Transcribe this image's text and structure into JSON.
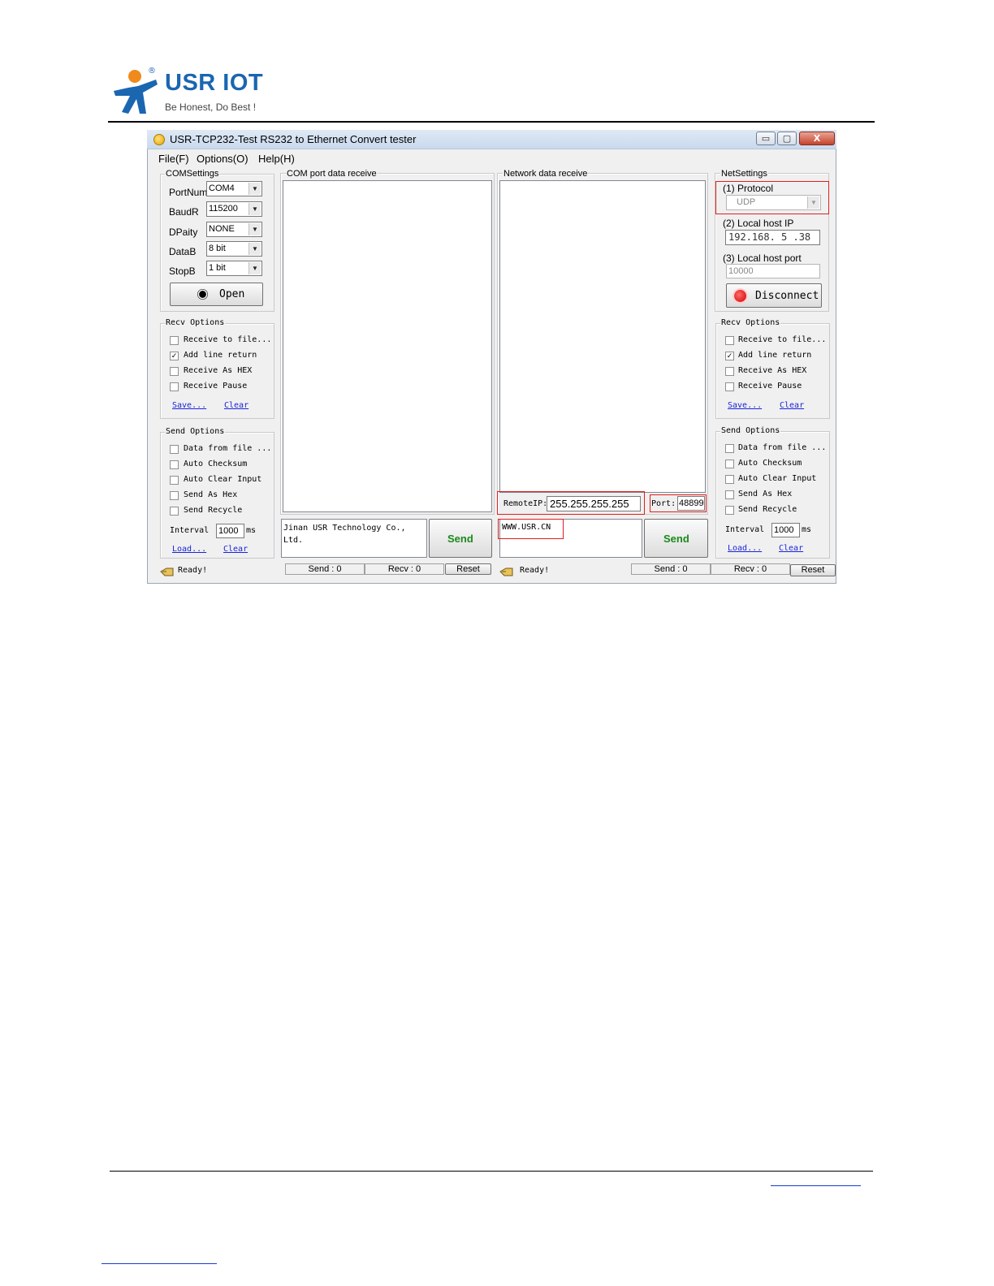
{
  "logo": {
    "brand": "USR IOT",
    "slogan": "Be Honest, Do Best !",
    "registered": "®"
  },
  "window": {
    "title": "USR-TCP232-Test  RS232 to Ethernet Convert tester",
    "minimize": "▭",
    "maximize": "▢",
    "close": "X"
  },
  "menu": {
    "file": "File(F)",
    "options": "Options(O)",
    "help": "Help(H)"
  },
  "com_settings": {
    "title": "COMSettings",
    "port_num_label": "PortNum",
    "port_num": "COM4",
    "baud_label": "BaudR",
    "baud": "115200",
    "parity_label": "DPaity",
    "parity": "NONE",
    "data_label": "DataB",
    "data": "8 bit",
    "stop_label": "StopB",
    "stop": "1 bit",
    "open_button": "Open"
  },
  "left_recv_options": {
    "title": "Recv Options",
    "receive_to_file": "Receive to file...",
    "add_line_return": "Add line return",
    "receive_as_hex": "Receive As HEX",
    "receive_pause": "Receive Pause",
    "save": "Save...",
    "clear": "Clear"
  },
  "left_send_options": {
    "title": "Send Options",
    "data_from_file": "Data from file ...",
    "auto_checksum": "Auto Checksum",
    "auto_clear_input": "Auto Clear Input",
    "send_as_hex": "Send As Hex",
    "send_recycle": "Send Recycle",
    "interval_label": "Interval",
    "interval": "1000",
    "interval_unit": "ms",
    "load": "Load...",
    "clear": "Clear"
  },
  "com_receive": {
    "title": "COM port data receive"
  },
  "com_send": {
    "text": "Jinan USR Technology Co., Ltd.",
    "send_button": "Send"
  },
  "left_status": {
    "ready": "Ready!",
    "send": "Send : 0",
    "recv": "Recv : 0",
    "reset": "Reset"
  },
  "network_receive": {
    "title": "Network data receive"
  },
  "remote": {
    "ip_label": "RemoteIP:",
    "ip": "255.255.255.255",
    "port_label": "Port:",
    "port": "48899"
  },
  "network_send": {
    "text": "WWW.USR.CN",
    "send_button": "Send"
  },
  "right_status": {
    "ready": "Ready!",
    "send": "Send : 0",
    "recv": "Recv : 0",
    "reset": "Reset"
  },
  "net_settings": {
    "title": "NetSettings",
    "protocol_label": "(1) Protocol",
    "protocol": "UDP",
    "local_ip_label": "(2) Local host IP",
    "local_ip": "192.168. 5 .38",
    "local_port_label": "(3) Local host port",
    "local_port": "10000",
    "disconnect_button": "Disconnect"
  },
  "right_recv_options": {
    "title": "Recv Options",
    "receive_to_file": "Receive to file...",
    "add_line_return": "Add line return",
    "receive_as_hex": "Receive As HEX",
    "receive_pause": "Receive Pause",
    "save": "Save...",
    "clear": "Clear"
  },
  "right_send_options": {
    "title": "Send Options",
    "data_from_file": "Data from file ...",
    "auto_checksum": "Auto Checksum",
    "auto_clear_input": "Auto Clear Input",
    "send_as_hex": "Send As Hex",
    "send_recycle": "Send Recycle",
    "interval_label": "Interval",
    "interval": "1000",
    "interval_unit": "ms",
    "load": "Load...",
    "clear": "Clear"
  },
  "checkmark": "✓",
  "colors": {
    "brand": "#1a66b0",
    "highlight_red": "#e01f1f",
    "send_green": "#1b8a1b",
    "link": "#1a24d8"
  }
}
